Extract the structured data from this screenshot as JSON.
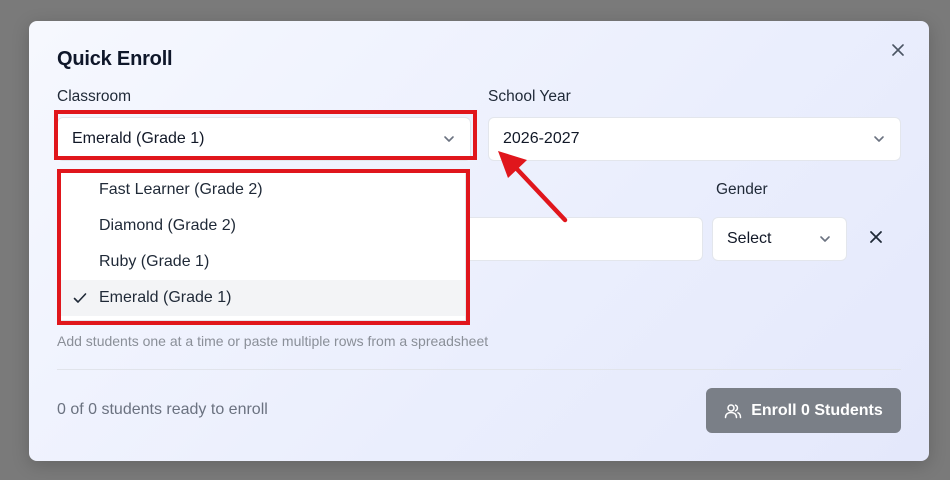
{
  "modal": {
    "title": "Quick Enroll",
    "close_icon": "close-icon"
  },
  "classroom": {
    "label": "Classroom",
    "value": "Emerald (Grade 1)",
    "options": [
      {
        "label": "Fast Learner (Grade 2)",
        "selected": false
      },
      {
        "label": "Diamond (Grade 2)",
        "selected": false
      },
      {
        "label": "Ruby (Grade 1)",
        "selected": false
      },
      {
        "label": "Emerald (Grade 1)",
        "selected": true
      }
    ]
  },
  "school_year": {
    "label": "School Year",
    "value": "2026-2027"
  },
  "student_row": {
    "gender_label": "Gender",
    "gender_value": "Select"
  },
  "hint": "Add students one at a time or paste multiple rows from a spreadsheet",
  "footer": {
    "status": "0 of 0 students ready to enroll",
    "enroll_button": "Enroll 0 Students"
  },
  "colors": {
    "highlight": "#e0161c",
    "button": "#7a7f87"
  }
}
